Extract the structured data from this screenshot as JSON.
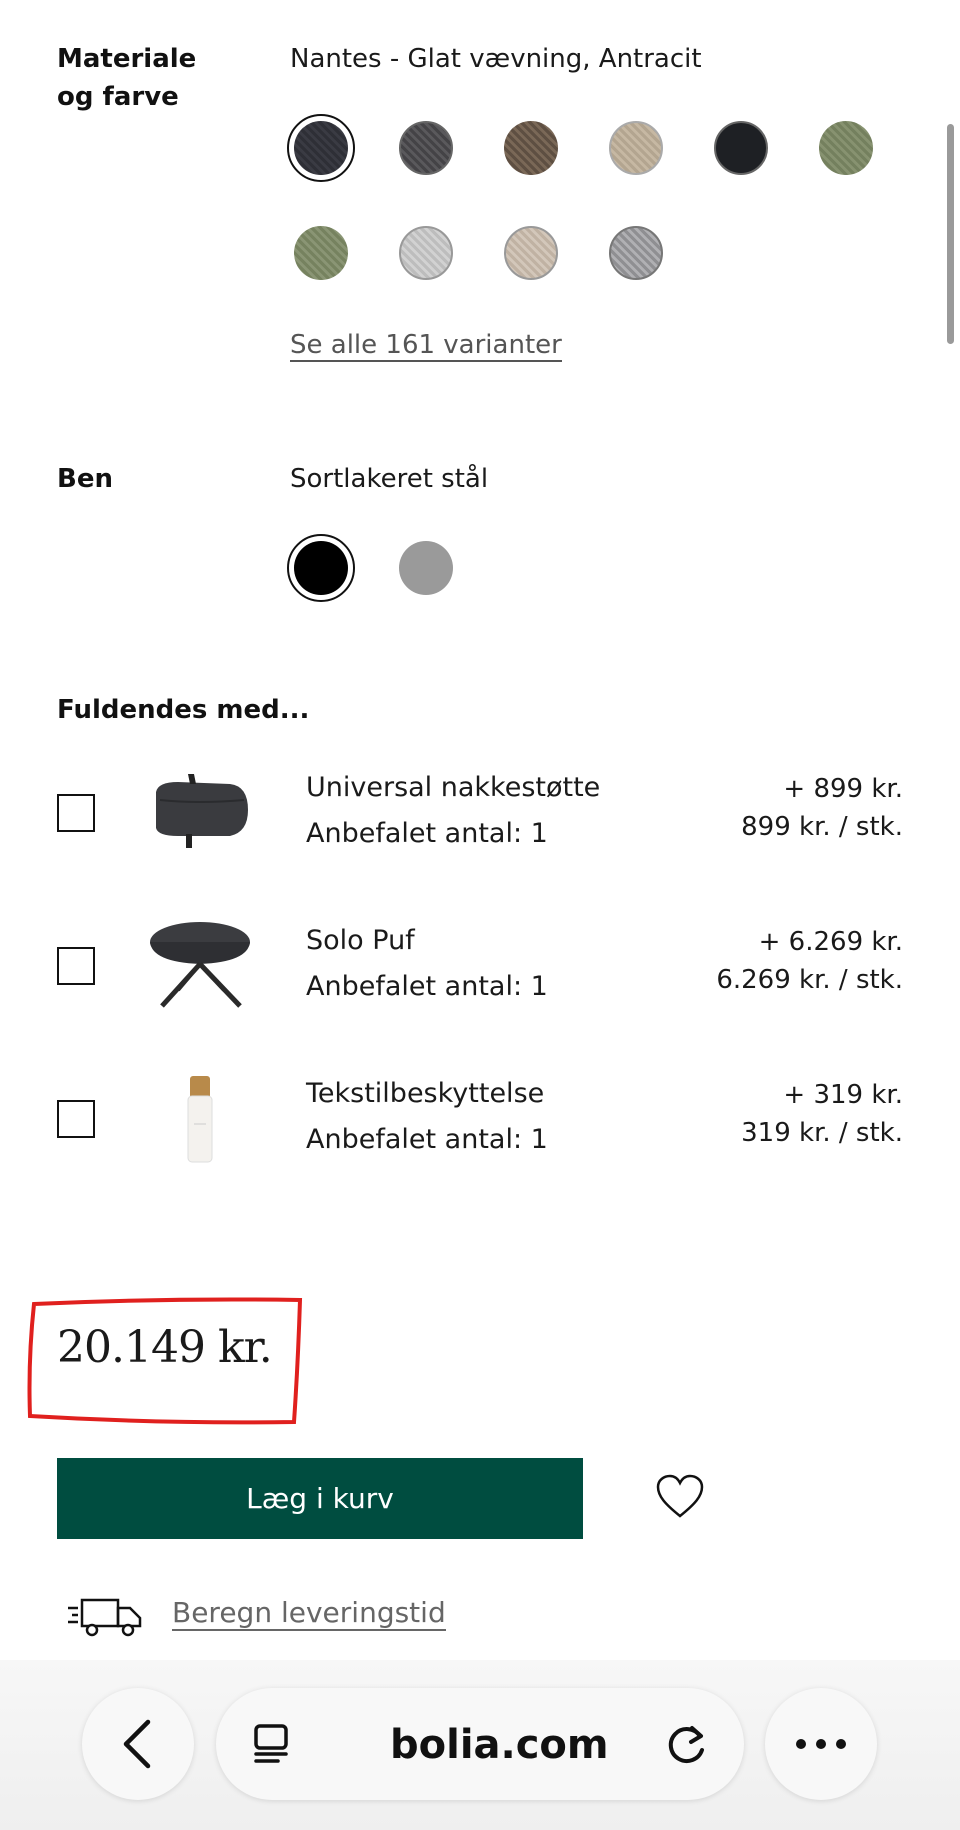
{
  "material": {
    "label": "Materiale\nog farve",
    "label_line1": "Materiale",
    "label_line2": "og farve",
    "selected_value": "Nantes - Glat vævning, Antracit",
    "swatches": [
      {
        "name": "antracit",
        "color": "#2e2f36",
        "selected": true
      },
      {
        "name": "dark-grey",
        "color": "#4b4a4c"
      },
      {
        "name": "brown",
        "color": "#6b5a4b"
      },
      {
        "name": "sand",
        "color": "#b9ab97"
      },
      {
        "name": "black",
        "color": "#1e2024"
      },
      {
        "name": "olive",
        "color": "#7d8766"
      },
      {
        "name": "sage",
        "color": "#7f8b6c"
      },
      {
        "name": "light-grey",
        "color": "#c5c5c5"
      },
      {
        "name": "beige",
        "color": "#c6b9ab"
      },
      {
        "name": "grey",
        "color": "#9b9b9e"
      }
    ],
    "see_all_link": "Se alle 161 varianter"
  },
  "legs": {
    "label": "Ben",
    "selected_value": "Sortlakeret stål",
    "swatches": [
      {
        "name": "black",
        "color": "#000000",
        "selected": true
      },
      {
        "name": "grey",
        "color": "#9a9a9a"
      }
    ]
  },
  "accessories": {
    "title": "Fuldendes med...",
    "items": [
      {
        "name": "Universal nakkestøtte",
        "recommended": "Anbefalet antal: 1",
        "price_add": "+ 899 kr.",
        "unit_price": "899 kr. / stk."
      },
      {
        "name": "Solo Puf",
        "recommended": "Anbefalet antal: 1",
        "price_add": "+ 6.269 kr.",
        "unit_price": "6.269 kr. / stk."
      },
      {
        "name": "Tekstilbeskyttelse",
        "recommended": "Anbefalet antal: 1",
        "price_add": "+ 319 kr.",
        "unit_price": "319 kr. / stk."
      }
    ]
  },
  "total_price": "20.149 kr.",
  "add_to_cart_label": "Læg i kurv",
  "delivery_link": "Beregn leveringstid",
  "browser": {
    "url": "bolia.com"
  },
  "colors": {
    "brand_green": "#004d40",
    "annotation_red": "#e0201e"
  }
}
